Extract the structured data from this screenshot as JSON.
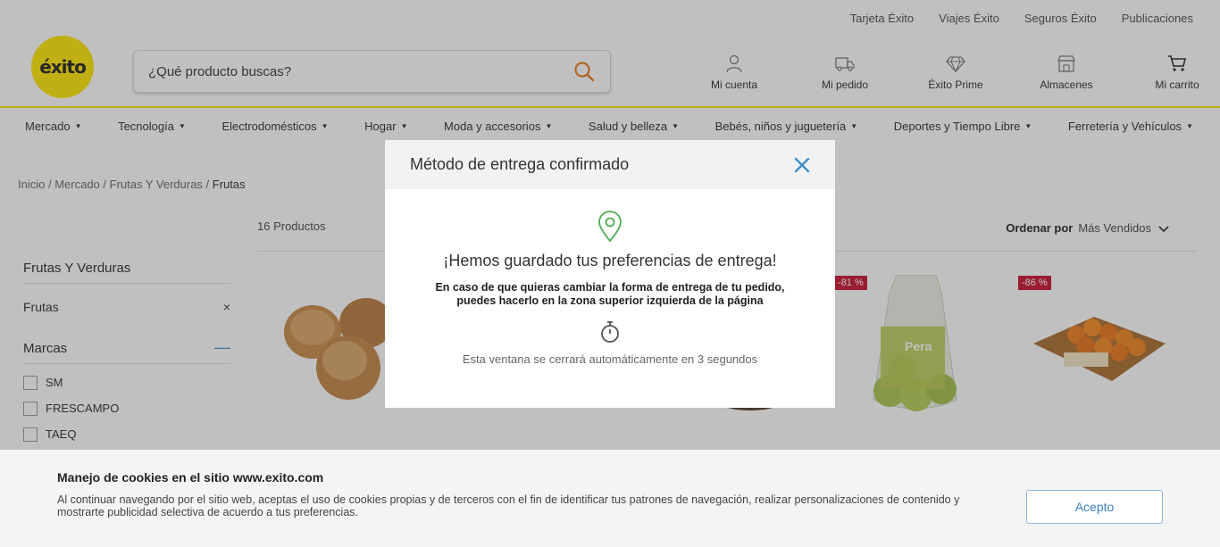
{
  "top_links": [
    "Tarjeta Éxito",
    "Viajes Éxito",
    "Seguros Éxito",
    "Publicaciones"
  ],
  "logo": {
    "text": "éxito"
  },
  "search": {
    "placeholder": "¿Qué producto buscas?"
  },
  "header_actions": [
    {
      "label": "Mi cuenta",
      "icon": "user-icon"
    },
    {
      "label": "Mi pedido",
      "icon": "truck-icon"
    },
    {
      "label": "Éxito Prime",
      "icon": "diamond-icon"
    },
    {
      "label": "Almacenes",
      "icon": "store-icon"
    },
    {
      "label": "Mi carrito",
      "icon": "cart-icon"
    }
  ],
  "nav": [
    "Mercado",
    "Tecnología",
    "Electrodomésticos",
    "Hogar",
    "Moda y accesorios",
    "Salud y belleza",
    "Bebés, niños y juguetería",
    "Deportes y Tiempo Libre",
    "Ferretería y Vehículos"
  ],
  "breadcrumb": {
    "items": [
      "Inicio",
      "Mercado",
      "Frutas Y Verduras"
    ],
    "current": "Frutas",
    "separator": " / "
  },
  "sidebar": {
    "category_title": "Frutas Y Verduras",
    "active_filter": "Frutas",
    "remove_symbol": "×",
    "brands_title": "Marcas",
    "collapse_symbol": "—",
    "brands": [
      "SM",
      "FRESCAMPO",
      "TAEQ"
    ]
  },
  "results": {
    "count": "16 Productos",
    "sort_label": "Ordenar por",
    "sort_value": "Más Vendidos"
  },
  "products": [
    {
      "discount": "-81 %"
    },
    {
      "discount": "-86 %"
    }
  ],
  "product_label_pera": "Pera",
  "modal": {
    "title": "Método de entrega confirmado",
    "heading": "¡Hemos guardado tus preferencias de entrega!",
    "text_line1": "En caso de que quieras cambiar la forma de entrega de tu pedido,",
    "text_line2": "puedes hacerlo en la zona superior izquierda de la página",
    "note": "Esta ventana se cerrará automáticamente en 3 segundos"
  },
  "cookie": {
    "title": "Manejo de cookies en el sitio www.exito.com",
    "text": "Al continuar navegando por el sitio web, aceptas el uso de cookies propias y de terceros con el fin de identificar tus patrones de navegación, realizar personalizaciones de contenido y mostrarte publicidad selectiva de acuerdo a tus preferencias.",
    "button": "Acepto"
  },
  "colors": {
    "brand_yellow": "#ffe600",
    "discount_red": "#c8102e",
    "accent_blue": "#3f8ed1",
    "pin_green": "#4caf50",
    "search_orange": "#e87c1e"
  }
}
